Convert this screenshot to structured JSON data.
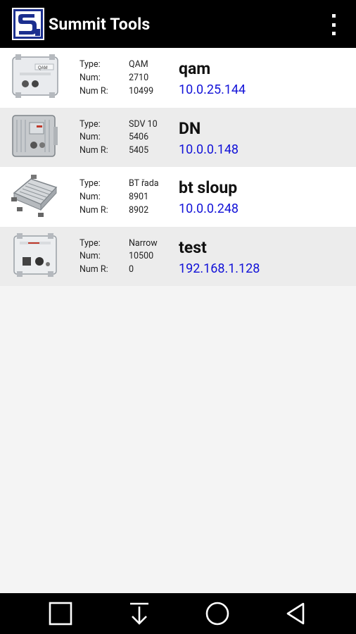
{
  "header": {
    "title": "Summit Tools"
  },
  "labels": {
    "type": "Type:",
    "num": "Num:",
    "num_r": "Num R:"
  },
  "devices": [
    {
      "name": "qam",
      "ip": "10.0.25.144",
      "type": "QAM",
      "num": "2710",
      "num_r": "10499",
      "image": "qam-node-image"
    },
    {
      "name": "DN",
      "ip": "10.0.0.148",
      "type": "SDV 10",
      "num": "5406",
      "num_r": "5405",
      "image": "sdv-node-image"
    },
    {
      "name": "bt sloup",
      "ip": "10.0.0.248",
      "type": "BT řada",
      "num": "8901",
      "num_r": "8902",
      "image": "bt-amplifier-image"
    },
    {
      "name": "test",
      "ip": "192.168.1.128",
      "type": "Narrow",
      "num": "10500",
      "num_r": "0",
      "image": "narrow-node-image"
    }
  ],
  "nav": {
    "recents": "square-icon",
    "download": "download-arrow-icon",
    "home": "circle-icon",
    "back": "triangle-back-icon"
  },
  "colors": {
    "action_bar": "#000000",
    "ip_text": "#1212d8",
    "row_alt": "#ececec",
    "background": "#f4f4f4"
  }
}
